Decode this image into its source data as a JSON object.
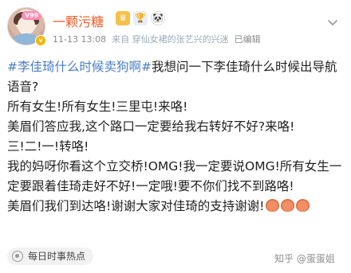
{
  "post": {
    "avatar_label": "",
    "level_badge": "V99",
    "username": "一颗污糖",
    "timestamp": "11-13 13:08",
    "source_prefix": "来自",
    "source_device": "穿仙女裙的张艺兴的兴迷",
    "edited": "已编辑",
    "hashtag": "#李佳琦什么时候卖狗啊#",
    "lines": [
      "我想问一下李佳琦什么时候出导航语音?",
      "所有女生!所有女生!三里屯!来咯!",
      "美眉们答应我,这个路口一定要给我右转好不好?来咯!",
      "三!二!一!转咯!",
      "我的妈呀你看这个立交桥!OMG!我一定要说OMG!所有女生一定要跟着佳琦走好不好!一定哦!要不你们找不到路咯!",
      "美眉们我们到达咯!谢谢大家对佳琦的支持谢谢!"
    ],
    "topic": "每日时事热点"
  },
  "watermark": "知乎 @蛋蛋姐",
  "colors": {
    "username": "#f45a24",
    "hashtag": "#4a7dc6",
    "meta": "#8a8a8a"
  },
  "icons": [
    "crown-icon",
    "trophy-icon",
    "panda-icon",
    "chevron-down-icon",
    "topic-icon",
    "emoji-icon"
  ]
}
